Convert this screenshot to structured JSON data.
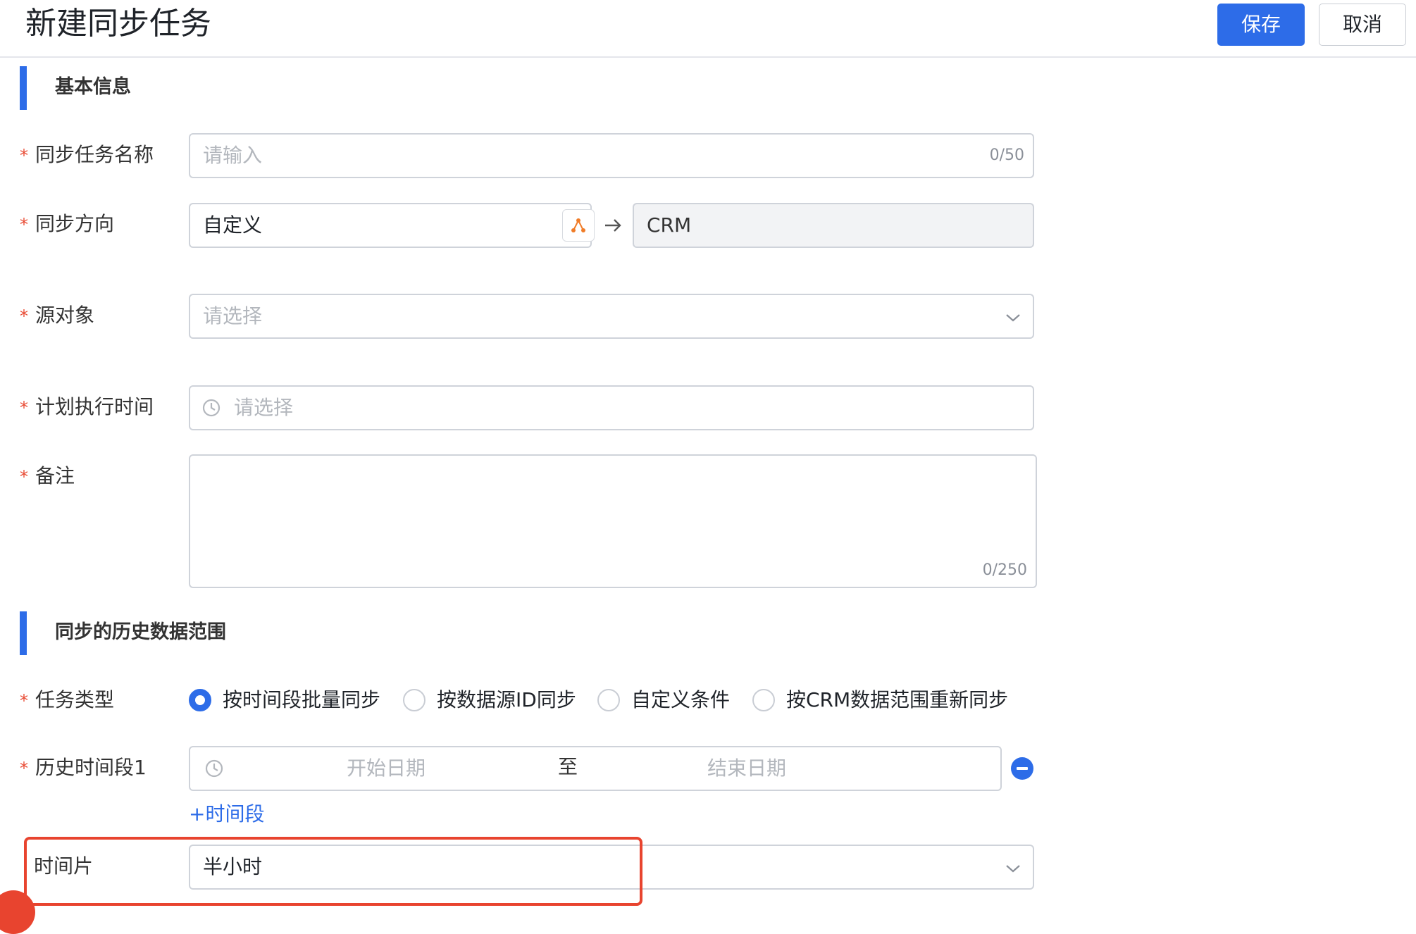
{
  "header": {
    "title": "新建同步任务",
    "save_label": "保存",
    "cancel_label": "取消"
  },
  "sections": {
    "basic": "基本信息",
    "history": "同步的历史数据范围"
  },
  "form": {
    "task_name": {
      "label": "同步任务名称",
      "placeholder": "请输入",
      "counter": "0/50"
    },
    "direction": {
      "label": "同步方向",
      "source_value": "自定义",
      "target_value": "CRM"
    },
    "source_object": {
      "label": "源对象",
      "placeholder": "请选择"
    },
    "schedule_time": {
      "label": "计划执行时间",
      "placeholder": "请选择"
    },
    "remark": {
      "label": "备注",
      "counter": "0/250"
    },
    "task_type": {
      "label": "任务类型",
      "options": [
        "按时间段批量同步",
        "按数据源ID同步",
        "自定义条件",
        "按CRM数据范围重新同步"
      ],
      "selected": "按时间段批量同步"
    },
    "history_range": {
      "label": "历史时间段1",
      "start_placeholder": "开始日期",
      "separator": "至",
      "end_placeholder": "结束日期",
      "add_label": "+时间段"
    },
    "time_slice": {
      "label": "时间片",
      "value": "半小时"
    }
  },
  "icons": {
    "source_picker": "branch-icon",
    "arrow": "arrow-right-icon",
    "clock": "clock-icon",
    "chevron": "chevron-down-icon",
    "remove": "minus-circle-icon"
  },
  "colors": {
    "primary": "#2d6ce8",
    "required": "#e84a33",
    "highlight": "#e8442f",
    "source_icon": "#f07c28"
  }
}
